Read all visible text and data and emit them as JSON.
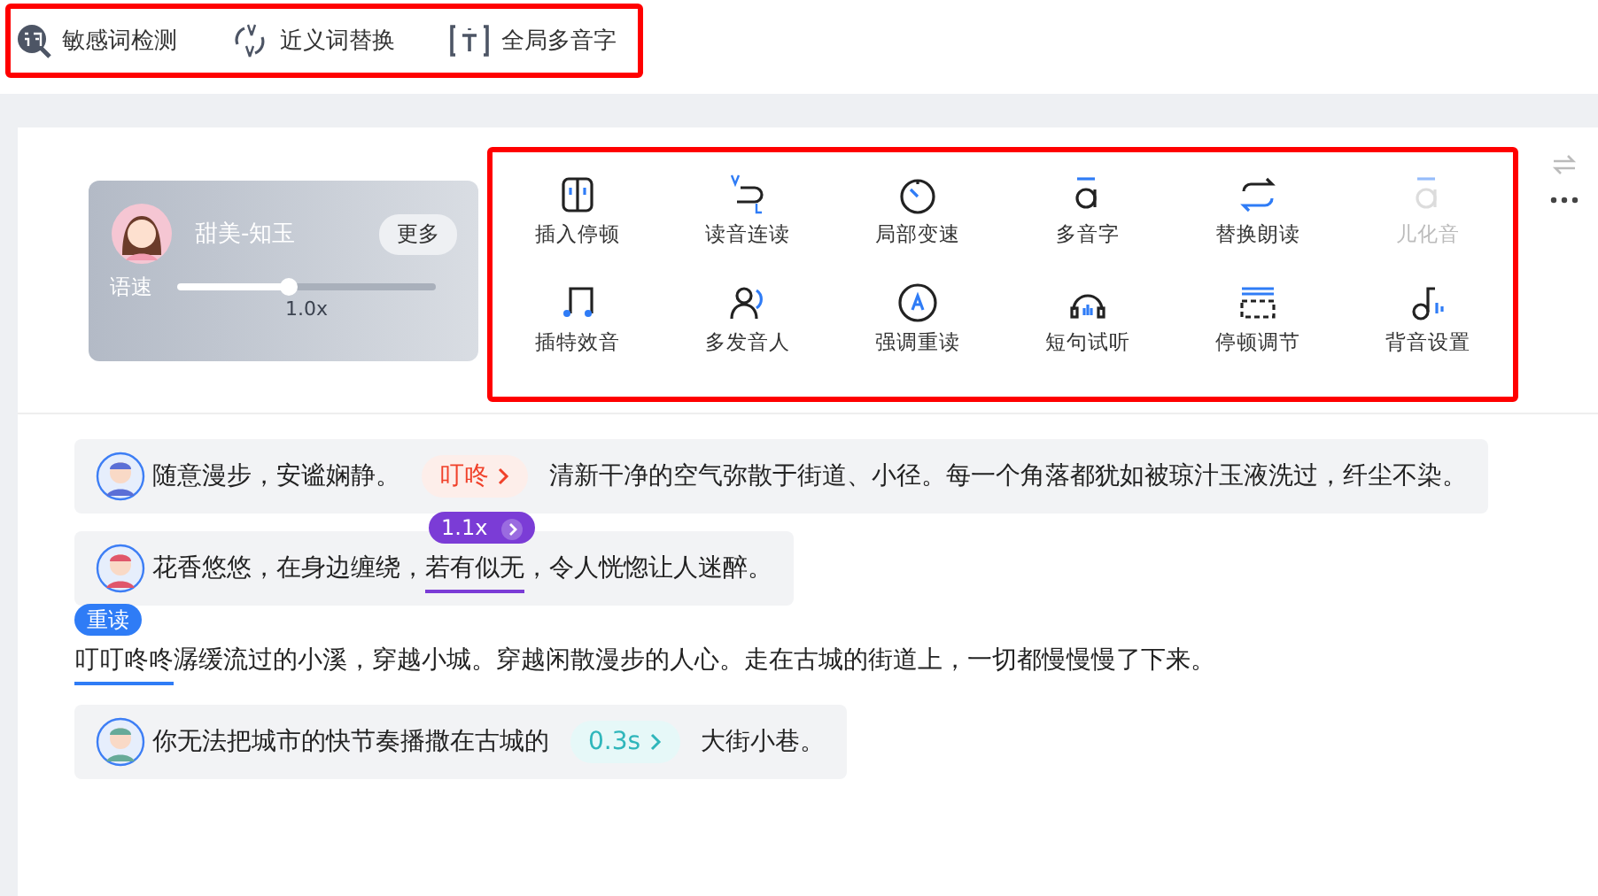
{
  "top_tools": [
    {
      "label": "敏感词检测"
    },
    {
      "label": "近义词替换"
    },
    {
      "label": "全局多音字"
    }
  ],
  "voice_card": {
    "name": "甜美-知玉",
    "more": "更多",
    "speed_label": "语速",
    "level": 0.43,
    "reading": "1.0x"
  },
  "tools": [
    {
      "label": "插入停顿",
      "disabled": false
    },
    {
      "label": "读音连读",
      "disabled": false
    },
    {
      "label": "局部变速",
      "disabled": false
    },
    {
      "label": "多音字",
      "disabled": false
    },
    {
      "label": "替换朗读",
      "disabled": false
    },
    {
      "label": "儿化音",
      "disabled": true
    },
    {
      "label": "插特效音",
      "disabled": false
    },
    {
      "label": "多发音人",
      "disabled": false
    },
    {
      "label": "强调重读",
      "disabled": false
    },
    {
      "label": "短句试听",
      "disabled": false
    },
    {
      "label": "停顿调节",
      "disabled": false
    },
    {
      "label": "背音设置",
      "disabled": false
    }
  ],
  "paragraphs": [
    {
      "kind": "voice",
      "segments": [
        {
          "kind": "text",
          "text": "随意漫步，安谧娴静。"
        },
        {
          "kind": "effect",
          "text": "叮咚"
        },
        {
          "kind": "text",
          "text": "清新干净的空气弥散于街道、小径。每一个角落都犹如被琼汁玉液洗过，纤尘不染。"
        }
      ]
    },
    {
      "kind": "voice",
      "segments": [
        {
          "kind": "text",
          "text": "花香悠悠，在身边缠绕，"
        },
        {
          "kind": "speed",
          "text": "若有似无",
          "badge": "1.1x"
        },
        {
          "kind": "text",
          "text": "，令人恍惚让人迷醉。"
        }
      ]
    },
    {
      "kind": "plain",
      "segments": [
        {
          "kind": "stress",
          "text": "叮叮咚咚",
          "badge": "重读"
        },
        {
          "kind": "text",
          "text": "潺缓流过的小溪，穿越小城。穿越闲散漫步的人心。走在古城的街道上，一切都慢慢慢了下来。"
        }
      ]
    },
    {
      "kind": "voice",
      "segments": [
        {
          "kind": "text",
          "text": "你无法把城市的快节奏播撒在古城的"
        },
        {
          "kind": "pause",
          "text": "0.3s"
        },
        {
          "kind": "text",
          "text": "大街小巷。"
        }
      ]
    }
  ]
}
